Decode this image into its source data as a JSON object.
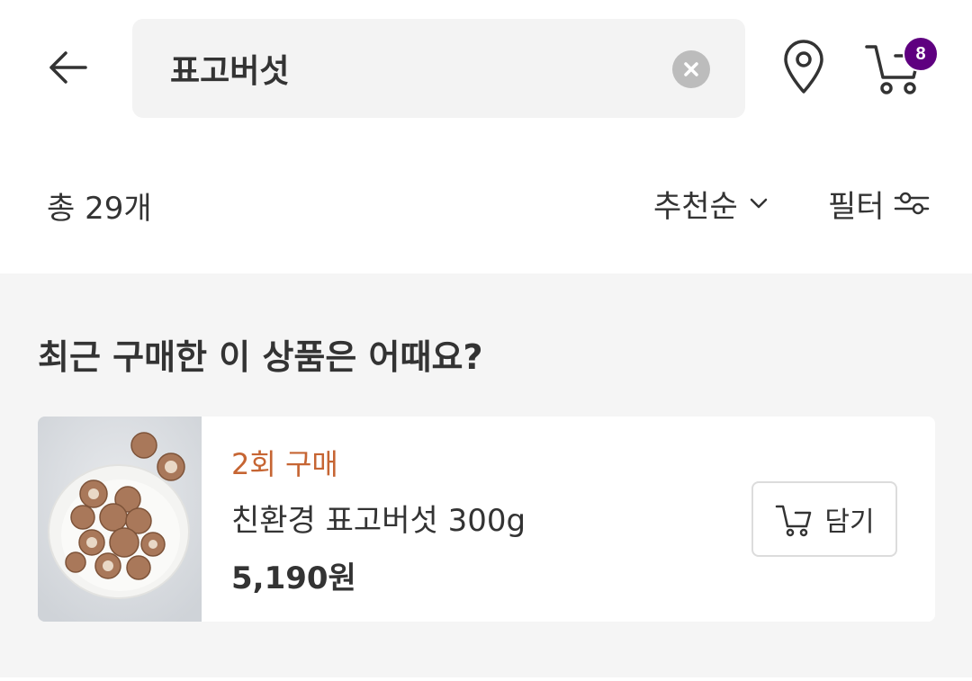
{
  "header": {
    "back_icon": "arrow-left-icon",
    "search": {
      "value": "표고버섯",
      "clear_icon": "clear-icon"
    },
    "location_icon": "location-pin-icon",
    "cart": {
      "icon": "cart-icon",
      "badge_count": "8"
    }
  },
  "toolbar": {
    "total_count": "총 29개",
    "sort_label": "추천순",
    "sort_icon": "chevron-down-icon",
    "filter_label": "필터",
    "filter_icon": "filter-sliders-icon"
  },
  "recent": {
    "title": "최근 구매한 이 상품은 어때요?",
    "product": {
      "image": "shiitake-mushroom-plate-image",
      "purchase_count": "2회 구매",
      "name": "친환경 표고버섯 300g",
      "price": "5,190원",
      "add_button_label": "담기",
      "add_button_icon": "cart-icon"
    }
  },
  "colors": {
    "brand_purple": "#5f0080",
    "purchase_orange": "#c66533",
    "section_bg": "#f5f5f5",
    "search_bg": "#f3f3f3"
  }
}
